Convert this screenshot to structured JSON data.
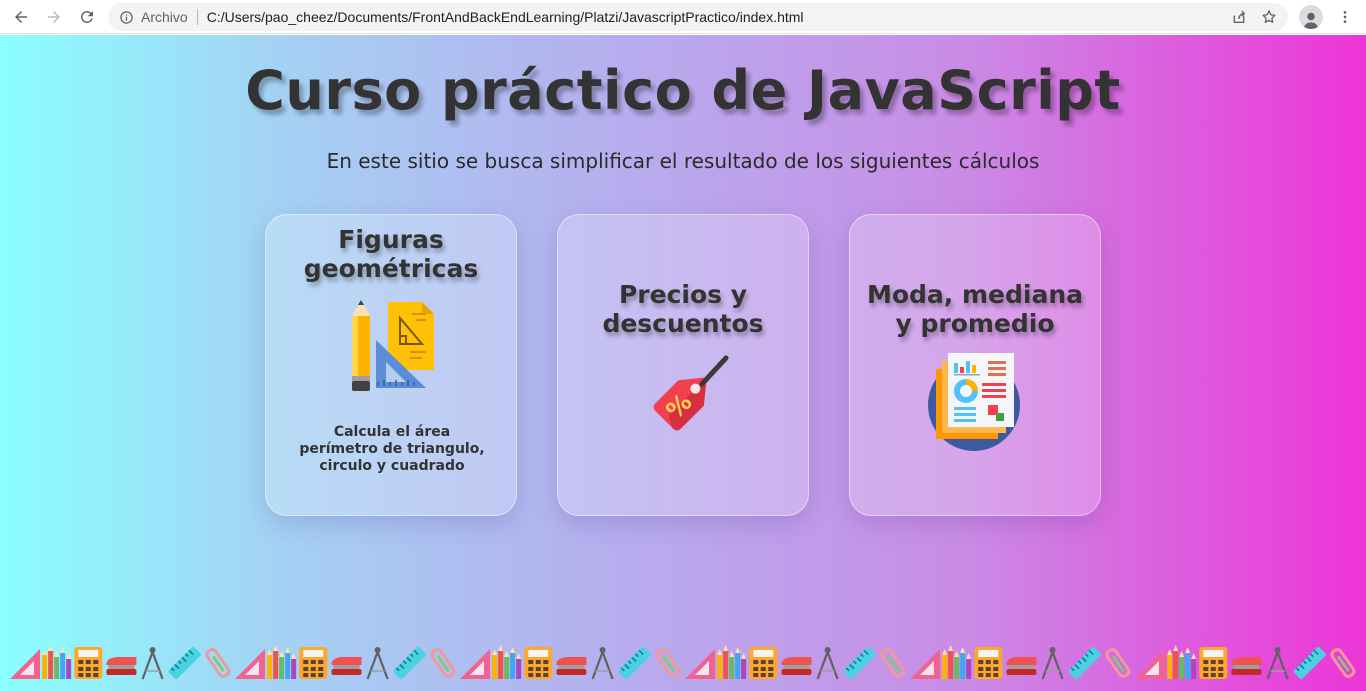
{
  "browser": {
    "scheme_label": "Archivo",
    "url": "C:/Users/pao_cheez/Documents/FrontAndBackEndLearning/Platzi/JavascriptPractico/index.html",
    "icons": [
      "back-arrow-icon",
      "forward-arrow-icon",
      "reload-icon",
      "info-icon",
      "share-icon",
      "star-icon",
      "profile-icon",
      "kebab-menu-icon"
    ]
  },
  "page": {
    "title": "Curso práctico de JavaScript",
    "subtitle": "En este sitio se busca simplificar el resultado de los siguientes cálculos",
    "background": [
      "#8affff",
      "#a4d2f4",
      "#b6aeee",
      "#c98de6",
      "#ee34d8"
    ],
    "text_color": "#333333"
  },
  "cards": [
    {
      "title_line1": "Figuras",
      "title_line2": "geométricas",
      "icon": "pencil-ruler-icon",
      "desc_line1": "Calcula el área",
      "desc_line2": "perímetro de triangulo,",
      "desc_line3": "circulo y cuadrado"
    },
    {
      "title_line1": "Precios y",
      "title_line2": "descuentos",
      "icon": "discount-tag-icon"
    },
    {
      "title_line1": "Moda, mediana",
      "title_line2": "y promedio",
      "icon": "report-chart-icon"
    }
  ],
  "footer_strip": {
    "icons": [
      "set-square-icon",
      "pencils-icon",
      "calculator-icon",
      "stapler-icon",
      "compass-icon",
      "ruler-icon",
      "paperclip-icon"
    ],
    "repeat": 6
  }
}
